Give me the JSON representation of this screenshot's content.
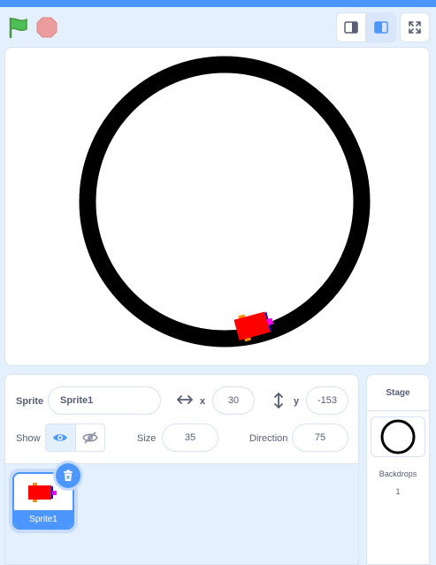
{
  "controls": {
    "green_flag": "green-flag-icon",
    "stop": "stop-icon",
    "small_stage": "small-stage-icon",
    "large_stage": "large-stage-icon",
    "fullscreen": "fullscreen-icon"
  },
  "sprite_info": {
    "sprite_label": "Sprite",
    "sprite_name": "Sprite1",
    "x_label": "x",
    "x_value": "30",
    "y_label": "y",
    "y_value": "-153",
    "show_label": "Show",
    "size_label": "Size",
    "size_value": "35",
    "direction_label": "Direction",
    "direction_value": "75"
  },
  "sprite_list": [
    {
      "name": "Sprite1",
      "selected": true
    }
  ],
  "stage_pane": {
    "title": "Stage",
    "backdrops_label": "Backdrops",
    "backdrops_count": "1"
  },
  "colors": {
    "accent": "#4c97ff",
    "background": "#e5f0ff",
    "car_body": "#ff0000",
    "car_wheels": "#ff8c00",
    "car_front": "#0000ff",
    "car_light": "#ff00ff",
    "track": "#000000"
  }
}
